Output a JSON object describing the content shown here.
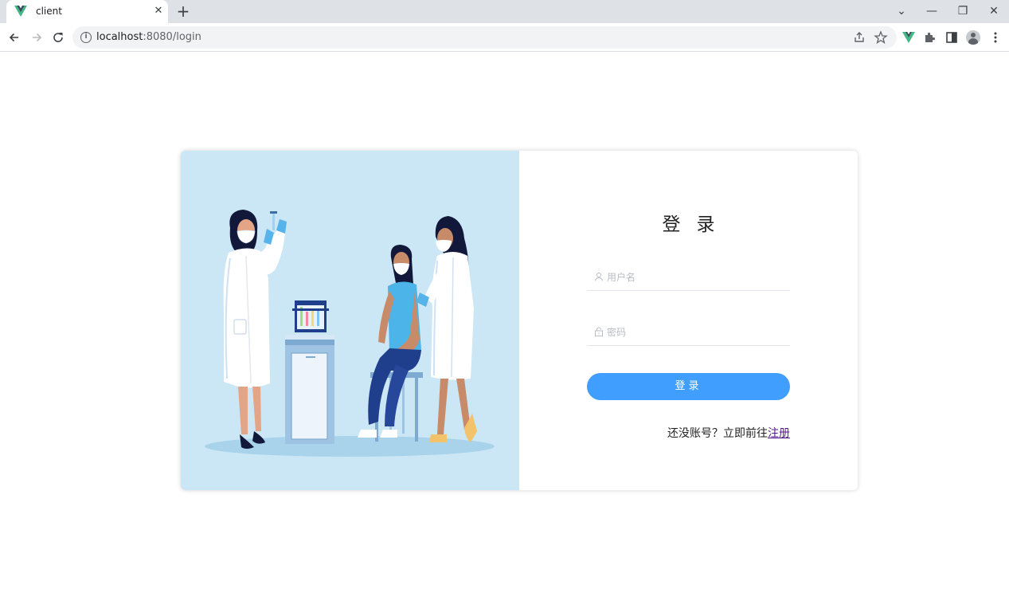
{
  "browser": {
    "tab_title": "client",
    "tab_close": "✕",
    "new_tab": "+",
    "url_host": "localhost",
    "url_rest": ":8080/login",
    "window_controls": {
      "dropdown": "⌄",
      "minimize": "—",
      "restore": "❐",
      "close": "✕"
    },
    "colors": {
      "tabstrip": "#dee1e6",
      "vue_green": "#41b883",
      "vue_dark": "#34495e"
    }
  },
  "login": {
    "title": "登录",
    "username_placeholder": "用户名",
    "password_placeholder": "密码",
    "submit_label": "登录",
    "register_prompt": "还没账号？立即前往",
    "register_link": "注册",
    "colors": {
      "primary": "#409eff",
      "illustration_bg": "#cbe6f4",
      "link": "#551a8b"
    }
  },
  "icons": {
    "favicon": "vue-logo-icon",
    "back": "arrow-left-icon",
    "forward": "arrow-right-icon",
    "reload": "reload-icon",
    "info": "info-icon",
    "share": "share-icon",
    "star": "star-icon",
    "vue_devtools": "vue-devtools-icon",
    "extensions": "puzzle-icon",
    "side_panel": "side-panel-icon",
    "profile": "profile-icon",
    "menu": "kebab-menu-icon",
    "user": "user-icon",
    "lock": "lock-icon"
  }
}
